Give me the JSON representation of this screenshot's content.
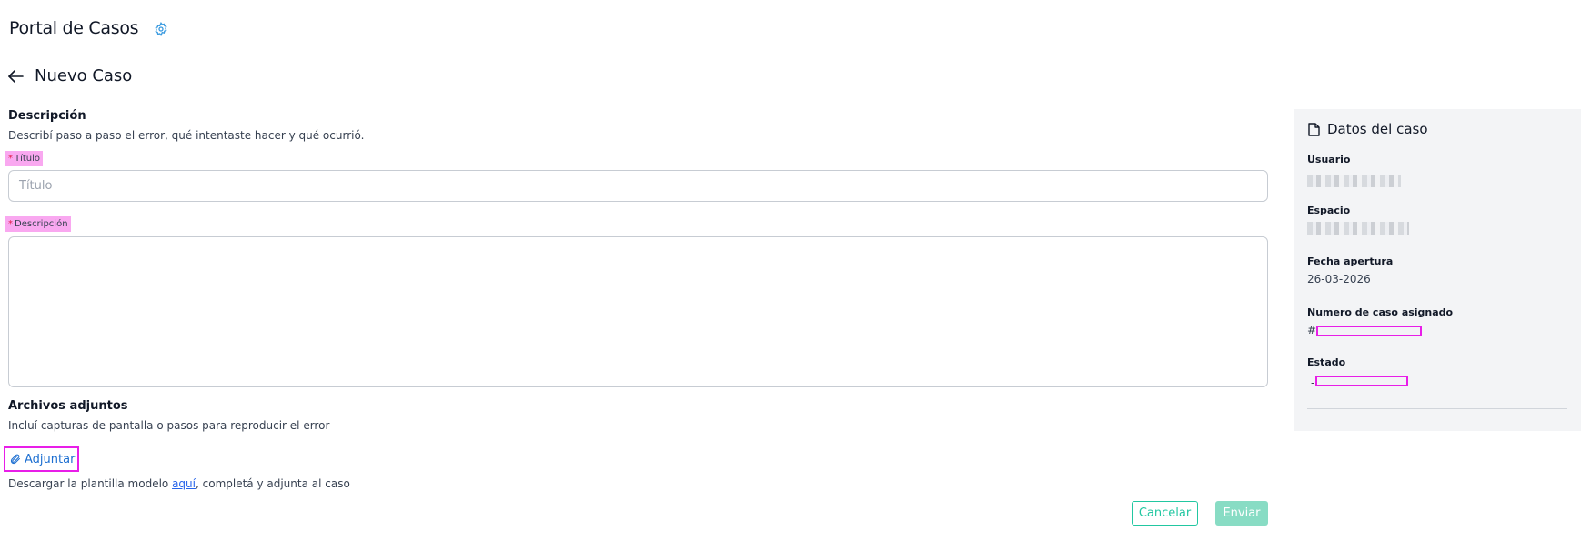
{
  "header": {
    "portal_title": "Portal de Casos",
    "page_title": "Nuevo Caso",
    "icons": [
      "gear-icon",
      "arrow-left-icon"
    ]
  },
  "form": {
    "description_section": {
      "title": "Descripción",
      "hint": "Describí paso a paso el error, qué intentaste hacer y qué ocurrió."
    },
    "title_field": {
      "label": "Título",
      "required_mark": "*",
      "placeholder": "Título",
      "value": ""
    },
    "description_field": {
      "label": "Descripción",
      "required_mark": "*",
      "value": ""
    },
    "attachments": {
      "title": "Archivos adjuntos",
      "hint": "Incluí capturas de pantalla o pasos para reproducir el error",
      "attach_label": "Adjuntar",
      "download_prefix": "Descargar la plantilla modelo ",
      "download_link": "aquí",
      "download_suffix": ", completá y adjunta al caso"
    },
    "actions": {
      "cancel": "Cancelar",
      "submit": "Enviar"
    }
  },
  "case_panel": {
    "title": "Datos del caso",
    "user_label": "Usuario",
    "space_label": "Espacio",
    "open_date_label": "Fecha apertura",
    "open_date": "26-03-2026",
    "case_number_label": "Numero de caso asignado",
    "case_number_prefix": "#",
    "status_label": "Estado",
    "status_prefix": "-"
  },
  "colors": {
    "accent": "#22c7a1",
    "accent_disabled": "#88dcc4",
    "link": "#1d6fd1",
    "highlight": "#f9a8f0",
    "redaction": "#e81ee8",
    "panel_bg": "#f3f4f6"
  }
}
